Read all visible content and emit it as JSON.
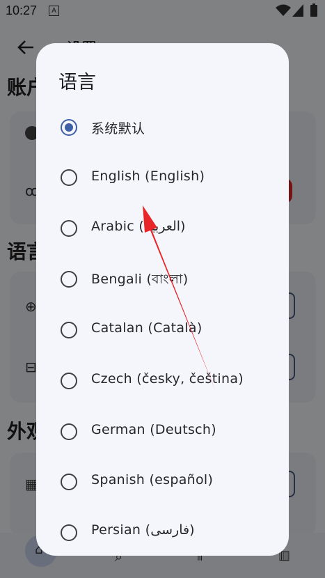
{
  "status_bar": {
    "time": "10:27"
  },
  "background": {
    "header_title": "设置",
    "section_account": "账户",
    "section_language": "语言",
    "section_appearance": "外观"
  },
  "dialog": {
    "title": "语言",
    "selected_index": 0,
    "options": [
      {
        "label": "系统默认"
      },
      {
        "label": "English (English)"
      },
      {
        "label": "Arabic (العربية)"
      },
      {
        "label": "Bengali (বাংলা)"
      },
      {
        "label": "Catalan (Català)"
      },
      {
        "label": "Czech (česky, čeština)"
      },
      {
        "label": "German (Deutsch)"
      },
      {
        "label": "Spanish (español)"
      },
      {
        "label": "Persian (فارسی)"
      }
    ]
  },
  "annotation": {
    "color": "#e8262a"
  },
  "colors": {
    "accent": "#3c5fa5"
  }
}
